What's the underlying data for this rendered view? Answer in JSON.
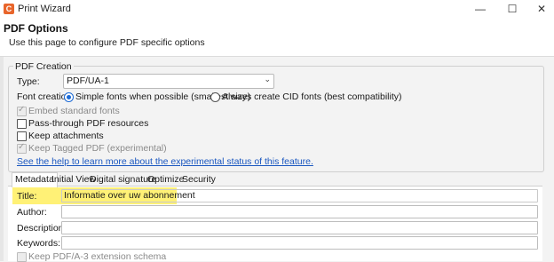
{
  "window": {
    "app_icon": "C",
    "title": "Print Wizard",
    "minimize": "—",
    "maximize": "☐",
    "close": "✕"
  },
  "header": {
    "title": "PDF Options",
    "description": "Use this page to configure PDF specific options"
  },
  "pdf_creation": {
    "legend": "PDF Creation",
    "type_label": "Type:",
    "type_value": "PDF/UA-1",
    "font_creation_label": "Font creation:",
    "font_options": [
      {
        "label": "Simple fonts when possible (smallest size)",
        "selected": true
      },
      {
        "label": "Always create CID fonts (best compatibility)",
        "selected": false
      }
    ],
    "checkboxes": [
      {
        "label": "Embed standard fonts",
        "checked": true,
        "disabled": true
      },
      {
        "label": "Pass-through PDF resources",
        "checked": false,
        "disabled": false
      },
      {
        "label": "Keep attachments",
        "checked": false,
        "disabled": false
      },
      {
        "label": "Keep Tagged PDF (experimental)",
        "checked": true,
        "disabled": true
      }
    ],
    "help_link": "See the help to learn more about the experimental status of this feature."
  },
  "tabs": [
    {
      "label": "Metadata",
      "active": true
    },
    {
      "label": "Initial View",
      "active": false
    },
    {
      "label": "Digital signature",
      "active": false
    },
    {
      "label": "Optimize",
      "active": false
    },
    {
      "label": "Security",
      "active": false
    }
  ],
  "metadata": {
    "title_label": "Title:",
    "title_value": "Informatie over uw abonnement",
    "author_label": "Author:",
    "author_value": "",
    "description_label": "Description:",
    "description_value": "",
    "keywords_label": "Keywords:",
    "keywords_value": "",
    "extension_schema_label": "Keep PDF/A-3 extension schema"
  },
  "colors": {
    "accent": "#1b6ad6",
    "highlight": "#fff176",
    "app_icon": "#e8652b",
    "link": "#1a57c0"
  },
  "icons": [
    "app-icon",
    "minimize-icon",
    "maximize-icon",
    "close-icon",
    "chevron-down-icon"
  ]
}
